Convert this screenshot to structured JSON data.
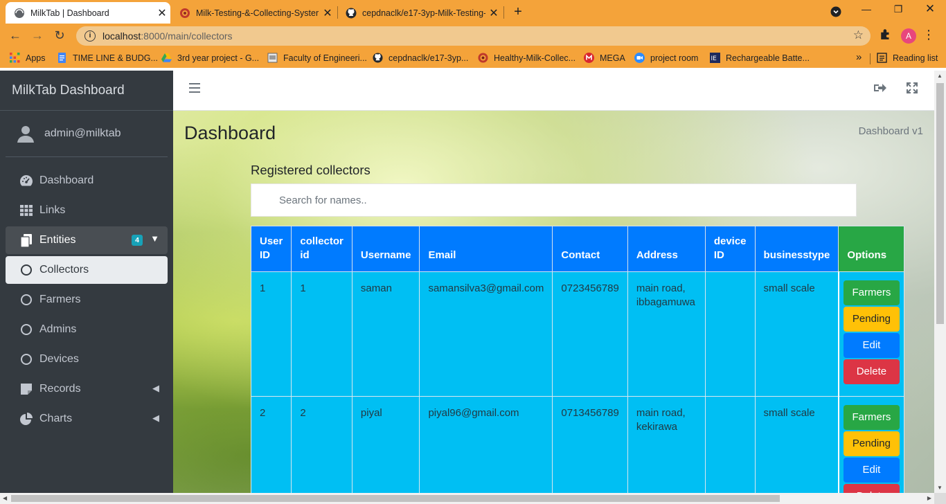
{
  "browser": {
    "tabs": [
      {
        "title": "MilkTab | Dashboard",
        "active": true
      },
      {
        "title": "Milk-Testing-&-Collecting-Syster",
        "active": false
      },
      {
        "title": "cepdnaclk/e17-3yp-Milk-Testing-",
        "active": false
      }
    ],
    "url_host": "localhost",
    "url_path": ":8000/main/collectors",
    "profile_initial": "A",
    "bookmarks": [
      {
        "label": "Apps",
        "icon": "apps-grid-icon"
      },
      {
        "label": "TIME LINE & BUDG...",
        "icon": "docs-icon"
      },
      {
        "label": "3rd year project - G...",
        "icon": "drive-icon"
      },
      {
        "label": "Faculty of Engineeri...",
        "icon": "page-icon"
      },
      {
        "label": "cepdnaclk/e17-3yp...",
        "icon": "github-icon"
      },
      {
        "label": "Healthy-Milk-Collec...",
        "icon": "site-icon"
      },
      {
        "label": "MEGA",
        "icon": "mega-icon"
      },
      {
        "label": "project room",
        "icon": "zoom-icon"
      },
      {
        "label": "Rechargeable Batte...",
        "icon": "battery-site-icon"
      }
    ],
    "overflow": "»",
    "reading_list": "Reading list"
  },
  "sidebar": {
    "brand": "MilkTab Dashboard",
    "user": "admin@milktab",
    "items": [
      {
        "label": "Dashboard",
        "icon": "tachometer-icon"
      },
      {
        "label": "Links",
        "icon": "grid-icon"
      },
      {
        "label": "Entities",
        "icon": "copy-icon",
        "badge": "4"
      },
      {
        "label": "Collectors",
        "icon": "circle-icon"
      },
      {
        "label": "Farmers",
        "icon": "circle-icon"
      },
      {
        "label": "Admins",
        "icon": "circle-icon"
      },
      {
        "label": "Devices",
        "icon": "circle-icon"
      },
      {
        "label": "Records",
        "icon": "sticky-note-icon"
      },
      {
        "label": "Charts",
        "icon": "pie-chart-icon"
      }
    ]
  },
  "content": {
    "title": "Dashboard",
    "breadcrumb": "Dashboard v1",
    "section_title": "Registered collectors",
    "search_placeholder": "Search for names..",
    "columns": [
      "User ID",
      "collector id",
      "Username",
      "Email",
      "Contact",
      "Address",
      "device ID",
      "businesstype",
      "Options"
    ],
    "rows": [
      {
        "user_id": "1",
        "collector_id": "1",
        "username": "saman",
        "email": "samansilva3@gmail.com",
        "contact": "0723456789",
        "address": "main road, ibbagamuwa",
        "device_id": "",
        "businesstype": "small scale"
      },
      {
        "user_id": "2",
        "collector_id": "2",
        "username": "piyal",
        "email": "piyal96@gmail.com",
        "contact": "0713456789",
        "address": "main road, kekirawa",
        "device_id": "",
        "businesstype": "small scale"
      }
    ],
    "options": {
      "farmers": "Farmers",
      "pending": "Pending",
      "edit": "Edit",
      "delete": "Delete"
    }
  },
  "colors": {
    "chrome": "#f4a33a",
    "sidebar": "#343a40",
    "header_blue": "#007bff",
    "cell_cyan": "#00bff3",
    "success": "#28a745",
    "warning": "#ffc107",
    "danger": "#dc3545"
  }
}
